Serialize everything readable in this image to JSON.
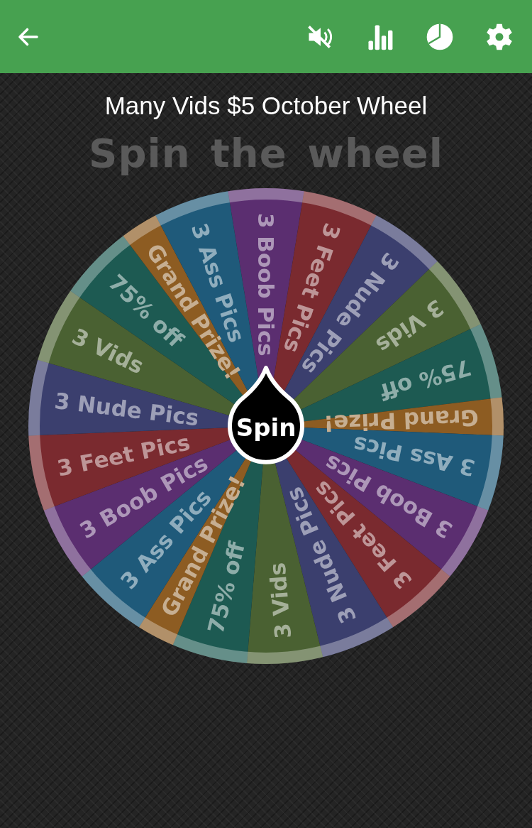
{
  "toolbar": {
    "buttons": [
      {
        "kind": "back"
      },
      {
        "kind": "mute"
      },
      {
        "kind": "stats"
      },
      {
        "kind": "pie"
      },
      {
        "kind": "settings"
      }
    ]
  },
  "title": "Many Vids $5 October Wheel",
  "subtitle": "Spin the wheel",
  "wheel": {
    "spin_label": "Spin",
    "segments": [
      {
        "label": "3 Boob Pics",
        "color": "#5b2e70",
        "kind": "wide"
      },
      {
        "label": "3 Feet Pics",
        "color": "#7a2a2f",
        "kind": "wide"
      },
      {
        "label": "3 Nude Pics",
        "color": "#3b3f6e",
        "kind": "wide"
      },
      {
        "label": "3 Vids",
        "color": "#4a6132",
        "kind": "wide"
      },
      {
        "label": "75% off",
        "color": "#1d5a52",
        "kind": "wide"
      },
      {
        "label": "Grand Prize!",
        "color": "#8d5c22",
        "kind": "narrow"
      },
      {
        "label": "3 Ass Pics",
        "color": "#1f5a7a",
        "kind": "wide"
      },
      {
        "label": "3 Boob Pics",
        "color": "#5b2e70",
        "kind": "wide"
      },
      {
        "label": "3 Feet Pics",
        "color": "#7a2a2f",
        "kind": "wide"
      },
      {
        "label": "3 Nude Pics",
        "color": "#3b3f6e",
        "kind": "wide"
      },
      {
        "label": "3 Vids",
        "color": "#4a6132",
        "kind": "wide"
      },
      {
        "label": "75% off",
        "color": "#1d5a52",
        "kind": "wide"
      },
      {
        "label": "Grand Prize!",
        "color": "#8d5c22",
        "kind": "narrow"
      },
      {
        "label": "3 Ass Pics",
        "color": "#1f5a7a",
        "kind": "wide"
      },
      {
        "label": "3 Boob Pics",
        "color": "#5b2e70",
        "kind": "wide"
      },
      {
        "label": "3 Feet Pics",
        "color": "#7a2a2f",
        "kind": "wide"
      },
      {
        "label": "3 Nude Pics",
        "color": "#3b3f6e",
        "kind": "wide"
      },
      {
        "label": "3 Vids",
        "color": "#4a6132",
        "kind": "wide"
      },
      {
        "label": "75% off",
        "color": "#1d5a52",
        "kind": "wide"
      },
      {
        "label": "Grand Prize!",
        "color": "#8d5c22",
        "kind": "narrow"
      },
      {
        "label": "3 Ass Pics",
        "color": "#1f5a7a",
        "kind": "wide"
      }
    ]
  }
}
